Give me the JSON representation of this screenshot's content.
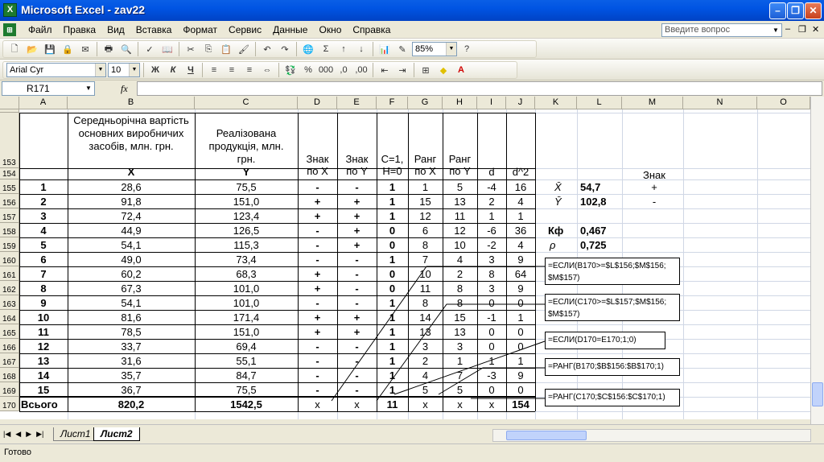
{
  "window": {
    "title": "Microsoft Excel - zav22",
    "app_icon": "X"
  },
  "menu": {
    "items": [
      "Файл",
      "Правка",
      "Вид",
      "Вставка",
      "Формат",
      "Сервис",
      "Данные",
      "Окно",
      "Справка"
    ],
    "help_placeholder": "Введите вопрос"
  },
  "toolbar": {
    "zoom": "85%"
  },
  "format_toolbar": {
    "font": "Arial Cyr",
    "size": "10",
    "bold": "Ж",
    "italic": "К",
    "underline": "Ч"
  },
  "formula_bar": {
    "name_box": "R171",
    "fx": "fx",
    "content": ""
  },
  "columns": [
    "A",
    "B",
    "C",
    "D",
    "E",
    "F",
    "G",
    "H",
    "I",
    "J",
    "K",
    "L",
    "M",
    "N",
    "O"
  ],
  "rows": [
    "153",
    "154",
    "155",
    "156",
    "157",
    "158",
    "159",
    "160",
    "161",
    "162",
    "163",
    "164",
    "165",
    "166",
    "167",
    "168",
    "169",
    "170"
  ],
  "table": {
    "headers": {
      "b": "Середньорічна вартість основних виробничих засобів, млн. грн.",
      "b_sym": "X",
      "c": "Реалізована продукція, млн. грн.",
      "c_sym": "Y",
      "d": "Знак по X",
      "e": "Знак по Y",
      "f": "C=1, H=0",
      "g": "Ранг по X",
      "h": "Ранг по Y",
      "i": "d",
      "j": "d^2"
    },
    "rows": [
      [
        "1",
        "28,6",
        "75,5",
        "-",
        "-",
        "1",
        "1",
        "5",
        "-4",
        "16"
      ],
      [
        "2",
        "91,8",
        "151,0",
        "+",
        "+",
        "1",
        "15",
        "13",
        "2",
        "4"
      ],
      [
        "3",
        "72,4",
        "123,4",
        "+",
        "+",
        "1",
        "12",
        "11",
        "1",
        "1"
      ],
      [
        "4",
        "44,9",
        "126,5",
        "-",
        "+",
        "0",
        "6",
        "12",
        "-6",
        "36"
      ],
      [
        "5",
        "54,1",
        "115,3",
        "-",
        "+",
        "0",
        "8",
        "10",
        "-2",
        "4"
      ],
      [
        "6",
        "49,0",
        "73,4",
        "-",
        "-",
        "1",
        "7",
        "4",
        "3",
        "9"
      ],
      [
        "7",
        "60,2",
        "68,3",
        "+",
        "-",
        "0",
        "10",
        "2",
        "8",
        "64"
      ],
      [
        "8",
        "67,3",
        "101,0",
        "+",
        "-",
        "0",
        "11",
        "8",
        "3",
        "9"
      ],
      [
        "9",
        "54,1",
        "101,0",
        "-",
        "-",
        "1",
        "8",
        "8",
        "0",
        "0"
      ],
      [
        "10",
        "81,6",
        "171,4",
        "+",
        "+",
        "1",
        "14",
        "15",
        "-1",
        "1"
      ],
      [
        "11",
        "78,5",
        "151,0",
        "+",
        "+",
        "1",
        "13",
        "13",
        "0",
        "0"
      ],
      [
        "12",
        "33,7",
        "69,4",
        "-",
        "-",
        "1",
        "3",
        "3",
        "0",
        "0"
      ],
      [
        "13",
        "31,6",
        "55,1",
        "-",
        "-",
        "1",
        "2",
        "1",
        "1",
        "1"
      ],
      [
        "14",
        "35,7",
        "84,7",
        "-",
        "-",
        "1",
        "4",
        "7",
        "-3",
        "9"
      ],
      [
        "15",
        "36,7",
        "75,5",
        "-",
        "-",
        "1",
        "5",
        "5",
        "0",
        "0"
      ]
    ],
    "total": [
      "Всього",
      "820,2",
      "1542,5",
      "x",
      "x",
      "11",
      "x",
      "x",
      "x",
      "154"
    ]
  },
  "side": {
    "znak_header": "Знак",
    "xbar_label": "X̄",
    "xbar_value": "54,7",
    "xbar_sign": "+",
    "ybar_label": "Ȳ",
    "ybar_value": "102,8",
    "ybar_sign": "-",
    "kf_label": "Кф",
    "kf_value": "0,467",
    "rho_label": "ρ",
    "rho_value": "0,725"
  },
  "notes": [
    "=ЕСЛИ(B170>=$L$156;$M$156; $M$157)",
    "=ЕСЛИ(C170>=$L$157;$M$156; $M$157)",
    "=ЕСЛИ(D170=E170;1;0)",
    "=РАНГ(B170;$B$156:$B$170;1)",
    "=РАНГ(C170;$C$156:$C$170;1)"
  ],
  "sheet_tabs": [
    "Лист1",
    "Лист2"
  ],
  "status": "Готово"
}
